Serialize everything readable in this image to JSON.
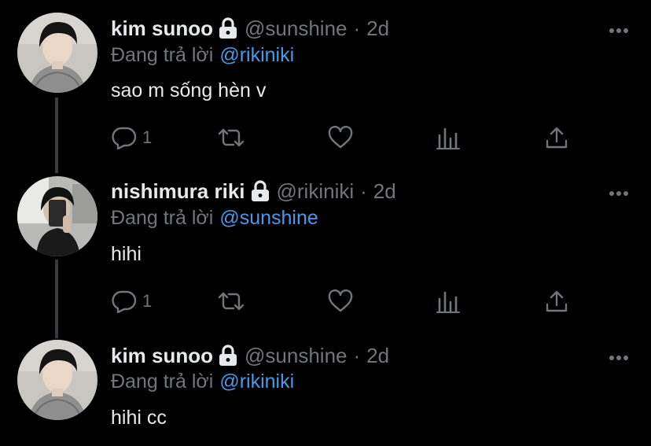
{
  "tweets": [
    {
      "name": "kim sunoo",
      "handle": "@sunshine",
      "sep": "·",
      "time": "2d",
      "reply_prefix": "Đang trả lời",
      "reply_to": "@rikiniki",
      "text": "sao m sống hèn v",
      "reply_count": "1"
    },
    {
      "name": "nishimura riki",
      "handle": "@rikiniki",
      "sep": "·",
      "time": "2d",
      "reply_prefix": "Đang trả lời",
      "reply_to": "@sunshine",
      "text": "hihi",
      "reply_count": "1"
    },
    {
      "name": "kim sunoo",
      "handle": "@sunshine",
      "sep": "·",
      "time": "2d",
      "reply_prefix": "Đang trả lời",
      "reply_to": "@rikiniki",
      "text": "hihi cc"
    }
  ],
  "icons": {
    "lock": "lock-icon",
    "more": "more-icon",
    "reply": "reply-icon",
    "retweet": "retweet-icon",
    "like": "heart-icon",
    "analytics": "analytics-icon",
    "share": "share-icon"
  },
  "colors": {
    "background": "#000000",
    "text": "#e7e9ea",
    "muted": "#71767b",
    "link": "#4a99e9",
    "thread_line": "#3a3d40"
  }
}
